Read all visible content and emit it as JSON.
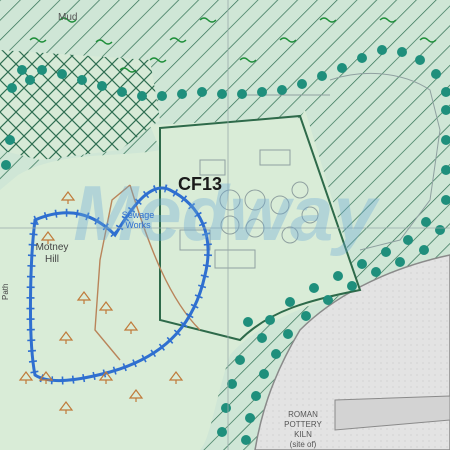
{
  "map": {
    "site_id": "CF13",
    "watermark": "Medway",
    "labels": {
      "mud": "Mud",
      "sewage_line1": "Sewage",
      "sewage_line2": "Works",
      "hill_line1": "Motney",
      "hill_line2": "Hill",
      "path": "Path",
      "pottery_line1": "ROMAN",
      "pottery_line2": "POTTERY",
      "pottery_line3": "KILN",
      "pottery_line4": "(site of)"
    },
    "colors": {
      "water_hatch_bg": "#cfe6d6",
      "hatch_line": "#2f6f52",
      "green_land": "#d9ecd7",
      "boundary": "#2e6a4a",
      "blue_boundary": "#2f6fd0",
      "dot_buffer": "#1f8f7c",
      "urban_grey": "#e6e6e6",
      "watermark": "#6aa9d8"
    },
    "icons": [
      "woodland-tree-icon",
      "marsh-symbol-icon"
    ]
  }
}
